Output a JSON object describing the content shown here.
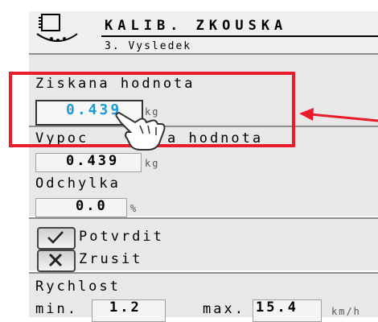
{
  "header": {
    "title": "KALIB. ZKOUSKA",
    "subtitle": "3. Vysledek",
    "icon": "scale-icon"
  },
  "measured": {
    "label": "Ziskana hodnota",
    "value": "0.439",
    "unit": "kg"
  },
  "calculated": {
    "label": "Vypoctena hodnota",
    "label_left": "Vypoc",
    "label_right": "a hodnota",
    "value": "0.439",
    "unit": "kg"
  },
  "deviation": {
    "label": "Odchylka",
    "value": "0.0",
    "unit": "%"
  },
  "actions": {
    "confirm_label": "Potvrdit",
    "cancel_label": "Zrusit"
  },
  "speed": {
    "label": "Rychlost",
    "min_label": "min.",
    "min_value": "1.2",
    "max_label": "max.",
    "max_value": "15.4",
    "unit": "km/h"
  },
  "annotation": {
    "highlight_color": "#ea1c2a",
    "value_color": "#1e9ad6",
    "pointer_icon": "hand-pointer-icon"
  }
}
